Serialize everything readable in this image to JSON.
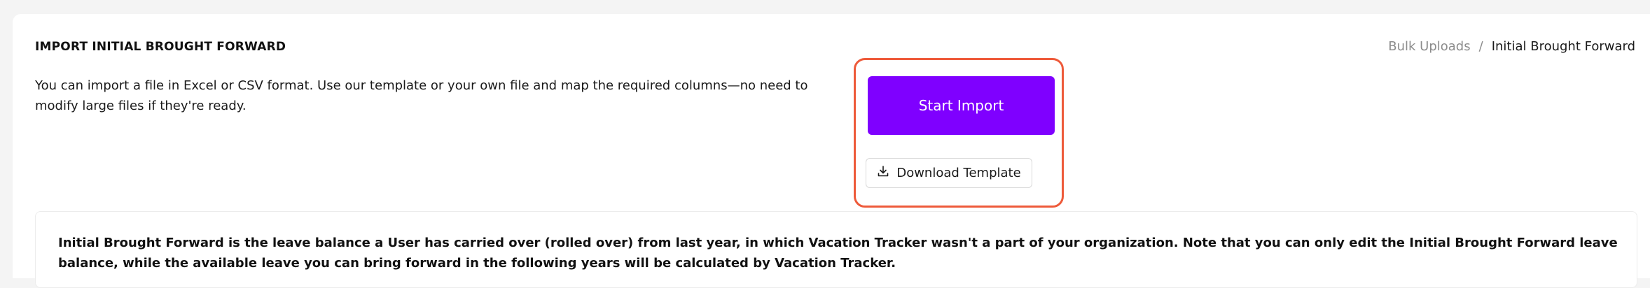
{
  "header": {
    "title": "IMPORT INITIAL BROUGHT FORWARD",
    "breadcrumb": {
      "parent": "Bulk Uploads",
      "separator": "/",
      "current": "Initial Brought Forward"
    }
  },
  "main": {
    "description": "You can import a file in Excel or CSV format. Use our template or your own file and map the required columns—no need to modify large files if they're ready.",
    "actions": {
      "start_import_label": "Start Import",
      "download_template_label": "Download Template",
      "download_icon": "download-icon"
    },
    "info": "Initial Brought Forward is the leave balance a User has carried over (rolled over) from last year, in which Vacation Tracker wasn't a part of your organization. Note that you can only edit the Initial Brought Forward leave balance, while the available leave you can bring forward in the following years will be calculated by Vacation Tracker."
  },
  "colors": {
    "primary": "#7f00ff",
    "highlight": "#ee5a3a",
    "background": "#f4f4f4"
  }
}
